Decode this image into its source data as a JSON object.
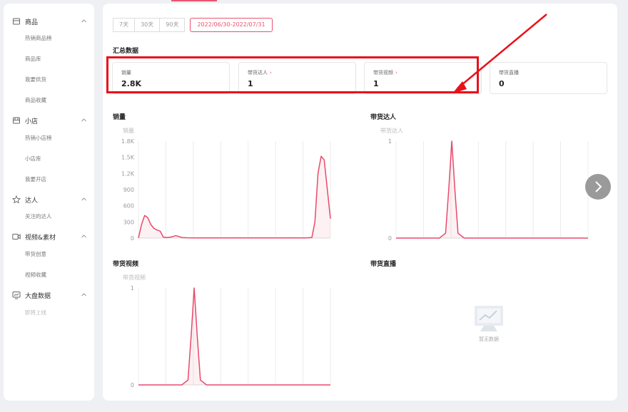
{
  "sidebar": {
    "groups": [
      {
        "label": "商品",
        "icon": "package-icon",
        "items": [
          "热销商品榜",
          "商品库",
          "我要供货",
          "商品收藏"
        ]
      },
      {
        "label": "小店",
        "icon": "store-icon",
        "items": [
          "热销小店榜",
          "小店库",
          "我要开店"
        ]
      },
      {
        "label": "达人",
        "icon": "star-icon",
        "items": [
          "关注的达人"
        ]
      },
      {
        "label": "视频&素材",
        "icon": "video-icon",
        "items": [
          "带货创意",
          "视频收藏"
        ]
      },
      {
        "label": "大盘数据",
        "icon": "dashboard-icon",
        "items": [
          "即将上线"
        ]
      }
    ]
  },
  "date_tabs": [
    "7天",
    "30天",
    "90天",
    "2022/06/30-2022/07/31"
  ],
  "summary": {
    "title": "汇总数据",
    "cards": [
      {
        "label": "销量",
        "value": "2.8K",
        "has_arrow": false
      },
      {
        "label": "带货达人",
        "value": "1",
        "has_arrow": true
      },
      {
        "label": "带货视频",
        "value": "1",
        "has_arrow": true
      },
      {
        "label": "带货直播",
        "value": "0",
        "has_arrow": false
      }
    ]
  },
  "chart_data": [
    {
      "type": "line",
      "title": "销量",
      "ylabel": "销量",
      "yticks": [
        "0",
        "300",
        "600",
        "900",
        "1.2K",
        "1.5K",
        "1.8K"
      ],
      "ylim": [
        0,
        1800
      ],
      "x": [
        0,
        0.5,
        1,
        1.5,
        2,
        2.5,
        3,
        3.5,
        4,
        4.5,
        5,
        5.5,
        6,
        6.5,
        7,
        8,
        9,
        10,
        11,
        12,
        13,
        14,
        15,
        16,
        17,
        18,
        19,
        20,
        21,
        22,
        23,
        24,
        25,
        26,
        27,
        28,
        28.5,
        29,
        29.5,
        30,
        30.5,
        31
      ],
      "values": [
        0,
        250,
        420,
        380,
        250,
        180,
        150,
        130,
        20,
        10,
        15,
        25,
        45,
        30,
        10,
        5,
        3,
        2,
        3,
        2,
        4,
        3,
        2,
        5,
        3,
        4,
        3,
        2,
        3,
        4,
        3,
        2,
        5,
        3,
        4,
        10,
        300,
        1200,
        1520,
        1450,
        900,
        360
      ],
      "color": "#e84a6b",
      "grid": true
    },
    {
      "type": "line",
      "title": "带货达人",
      "ylabel": "带货达人",
      "yticks": [
        "0",
        "1"
      ],
      "ylim": [
        0,
        1
      ],
      "x": [
        0,
        4,
        6,
        7,
        8,
        8.5,
        9,
        9.5,
        10,
        11,
        12,
        20,
        31
      ],
      "values": [
        0,
        0,
        0,
        0,
        0.05,
        0.5,
        1,
        0.5,
        0.05,
        0,
        0,
        0,
        0
      ],
      "color": "#e84a6b",
      "grid": true
    },
    {
      "type": "line",
      "title": "带货视频",
      "ylabel": "带货视频",
      "yticks": [
        "0",
        "1"
      ],
      "ylim": [
        0,
        1
      ],
      "x": [
        0,
        4,
        6,
        7,
        8,
        8.5,
        9,
        9.5,
        10,
        11,
        12,
        20,
        31
      ],
      "values": [
        0,
        0,
        0,
        0,
        0.05,
        0.5,
        1,
        0.5,
        0.05,
        0,
        0,
        0,
        0
      ],
      "color": "#e84a6b",
      "grid": true
    }
  ],
  "live_chart": {
    "title": "带货直播",
    "empty_text": "暂无数据"
  },
  "colors": {
    "accent": "#e84a6b",
    "highlight": "#e8111a"
  }
}
